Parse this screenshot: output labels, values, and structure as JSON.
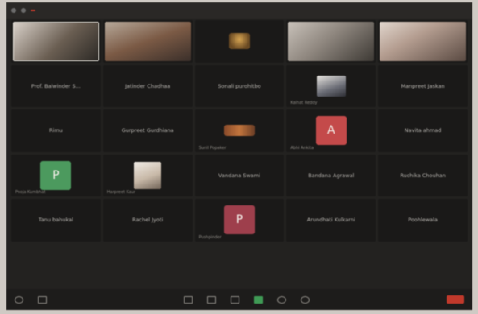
{
  "meeting": {
    "tiles": [
      {
        "name": "Prof. Balwinder S..."
      },
      {
        "name": "Jatinder Chadhaa"
      },
      {
        "name": "Sonali purohitbo"
      },
      {
        "name": "Kalhat Reddy"
      },
      {
        "name": "Manpreet Jaskan"
      },
      {
        "name": "Rimu"
      },
      {
        "name": "Gurpreet Gurdhiana"
      },
      {
        "name": "Sunil Popaker"
      },
      {
        "name": "Abhi Ankita"
      },
      {
        "name": "Navita ahmad"
      },
      {
        "name": "Pooja Kumbhat"
      },
      {
        "name": "Harpreet Kaur"
      },
      {
        "name": "Vandana Swami"
      },
      {
        "name": "Bandana Agrawal"
      },
      {
        "name": "Ruchika Chouhan"
      },
      {
        "name": "Tanu bahukal"
      },
      {
        "name": "Rachel Jyoti"
      },
      {
        "name": "Pushpinder"
      },
      {
        "name": "Arundhati Kulkarni"
      },
      {
        "name": "Poohlewala"
      }
    ],
    "avatars": {
      "a": "A",
      "p1": "P",
      "p2": "P"
    }
  },
  "colors": {
    "end": "#c0392b",
    "accent_green": "#3f9a55"
  }
}
